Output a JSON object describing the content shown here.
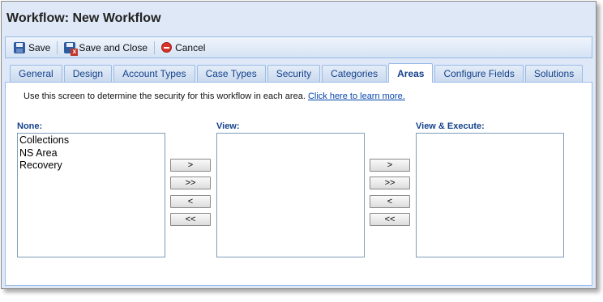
{
  "window": {
    "title": "Workflow: New Workflow"
  },
  "toolbar": {
    "save_label": "Save",
    "save_close_label": "Save and Close",
    "cancel_label": "Cancel"
  },
  "tabs": [
    {
      "label": "General"
    },
    {
      "label": "Design"
    },
    {
      "label": "Account Types"
    },
    {
      "label": "Case Types"
    },
    {
      "label": "Security"
    },
    {
      "label": "Categories"
    },
    {
      "label": "Areas",
      "active": true
    },
    {
      "label": "Configure Fields"
    },
    {
      "label": "Solutions"
    }
  ],
  "main": {
    "intro_text": "Use this screen to determine the security for this workflow in each area.",
    "learn_more_link": "Click here to learn more.",
    "lists": {
      "none": {
        "label": "None:",
        "items": [
          "Collections",
          "NS Area",
          "Recovery"
        ]
      },
      "view": {
        "label": "View:",
        "items": []
      },
      "view_execute": {
        "label": "View & Execute:",
        "items": []
      }
    },
    "move_buttons": {
      "move_right": ">",
      "move_all_right": ">>",
      "move_left": "<",
      "move_all_left": "<<"
    }
  }
}
